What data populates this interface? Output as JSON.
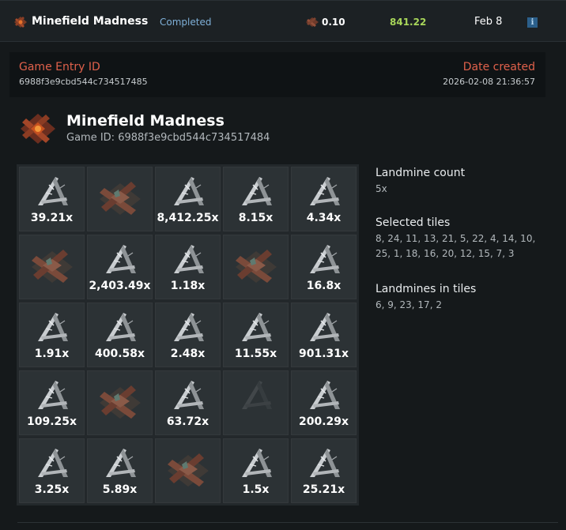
{
  "summary": {
    "game_name": "Minefield Madness",
    "status": "Completed",
    "bet": "0.10",
    "profit": "841.22",
    "date": "Feb 8",
    "info_icon": "i",
    "colors": {
      "status": "#7fb0d8",
      "profit": "#a8d65a",
      "label": "#e0614b"
    }
  },
  "details": {
    "entry_label": "Game Entry ID",
    "entry_value": "6988f3e9cbd544c734517485",
    "date_label": "Date created",
    "date_value": "2026-02-08 21:36:57"
  },
  "game": {
    "title": "Minefield Madness",
    "game_id": "Game ID: 6988f3e9cbd544c734517484"
  },
  "tiles": [
    {
      "type": "safe",
      "mult": "39.21x"
    },
    {
      "type": "mine",
      "mult": ""
    },
    {
      "type": "safe",
      "mult": "8,412.25x"
    },
    {
      "type": "safe",
      "mult": "8.15x"
    },
    {
      "type": "safe",
      "mult": "4.34x"
    },
    {
      "type": "mine",
      "mult": ""
    },
    {
      "type": "safe",
      "mult": "2,403.49x"
    },
    {
      "type": "safe",
      "mult": "1.18x"
    },
    {
      "type": "mine",
      "mult": ""
    },
    {
      "type": "safe",
      "mult": "16.8x"
    },
    {
      "type": "safe",
      "mult": "1.91x"
    },
    {
      "type": "safe",
      "mult": "400.58x"
    },
    {
      "type": "safe",
      "mult": "2.48x"
    },
    {
      "type": "safe",
      "mult": "11.55x"
    },
    {
      "type": "safe",
      "mult": "901.31x"
    },
    {
      "type": "safe",
      "mult": "109.25x"
    },
    {
      "type": "mine",
      "mult": ""
    },
    {
      "type": "safe",
      "mult": "63.72x"
    },
    {
      "type": "unrevealed",
      "mult": ""
    },
    {
      "type": "safe",
      "mult": "200.29x"
    },
    {
      "type": "safe",
      "mult": "3.25x"
    },
    {
      "type": "safe",
      "mult": "5.89x"
    },
    {
      "type": "mine",
      "mult": ""
    },
    {
      "type": "safe",
      "mult": "1.5x"
    },
    {
      "type": "safe",
      "mult": "25.21x"
    }
  ],
  "info": {
    "landmine_label": "Landmine count",
    "landmine_value": "5x",
    "selected_label": "Selected tiles",
    "selected_value": "8, 24, 11, 13, 21, 5, 22, 4, 14, 10, 25, 1, 18, 16, 20, 12, 15, 7, 3",
    "mines_label": "Landmines in tiles",
    "mines_value": "6, 9, 23, 17, 2"
  }
}
